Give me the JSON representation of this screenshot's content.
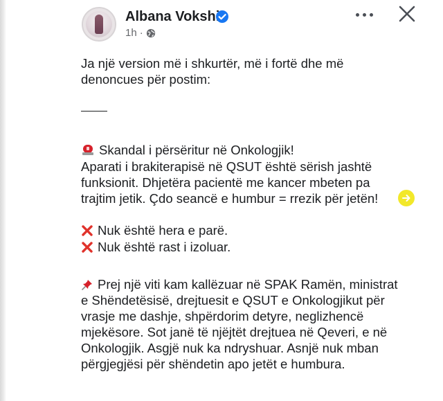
{
  "post": {
    "author": "Albana Vokshi",
    "time": "1h",
    "icons": {
      "verified": "verified-badge-icon",
      "audience": "globe-icon",
      "more": "more-options-icon",
      "close": "close-icon"
    },
    "colors": {
      "verified": "#1877f2",
      "meta": "#65676b",
      "cross": "#e0322b",
      "siren": "#d6212b",
      "arrow_bg": "#f2e82a"
    },
    "lines": {
      "intro_1": "Ja një version më i shkurtër, më i fortë dhe më",
      "intro_2": "denoncues për postim:",
      "headline": "Skandal i përsëritur në Onkologjik!",
      "p1_1": "Aparati i brakiterapisë në QSUT është sërish jashtë",
      "p1_2": "funksionit. Dhjetëra pacientë me kancer mbeten pa",
      "p1_3": "trajtim jetik. Çdo seancë e humbur = rrezik për jetën!",
      "x1": "Nuk është hera e parë.",
      "x2": "Nuk është rast i izoluar.",
      "p2_1": "Prej një viti kam kallëzuar në SPAK Ramën, ministrat",
      "p2_2": "e Shëndetësisë, drejtuesit e QSUT e Onkologjikut për",
      "p2_3": "vrasje me dashje, shpërdorim detyre, neglizhencë",
      "p2_4": "mjekësore. Sot janë të njëjtët drejtuea në Qeveri, e në",
      "p2_5": "Onkologjik. Asgjë nuk ka ndryshuar. Asnjë nuk mban",
      "p2_6": "përgjegjësi për shëndetin apo jetët e humbura."
    }
  }
}
